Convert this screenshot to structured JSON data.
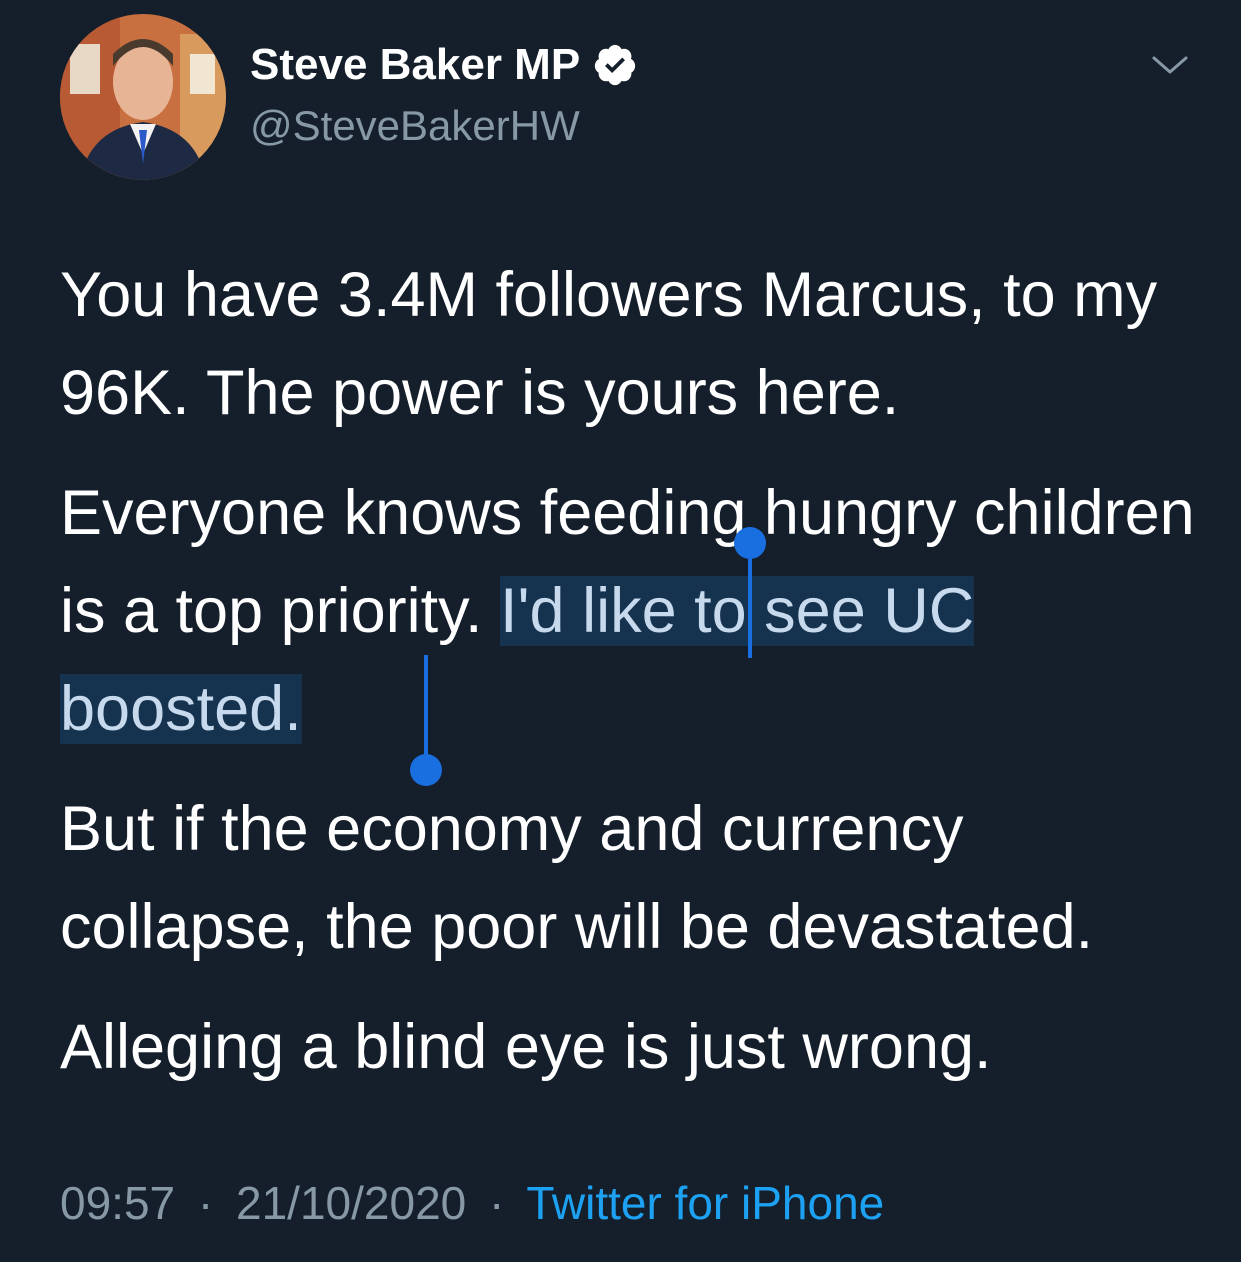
{
  "author": {
    "display_name": "Steve Baker MP",
    "handle": "@SteveBakerHW",
    "verified_icon": "verified-badge-icon",
    "avatar_icon": "avatar-photo"
  },
  "menu": {
    "caret_icon": "chevron-down-icon"
  },
  "tweet": {
    "p1": "You have 3.4M followers Marcus, to my 96K. The power is yours here.",
    "p2_plain": "Everyone knows feeding hungry children is a top priority. ",
    "p2_selected": "I'd like to see UC boosted.",
    "p3": "But if the economy and currency collapse, the poor will be devastated.",
    "p4": "Alleging a blind eye is just wrong."
  },
  "meta": {
    "time": "09:57",
    "separator": "·",
    "date": "21/10/2020",
    "source": "Twitter for iPhone"
  },
  "colors": {
    "background": "#151f2b",
    "secondary_text": "#8899a6",
    "link": "#1da1f2",
    "selection_bg": "#15324f",
    "selection_handle": "#1a6fe0"
  }
}
